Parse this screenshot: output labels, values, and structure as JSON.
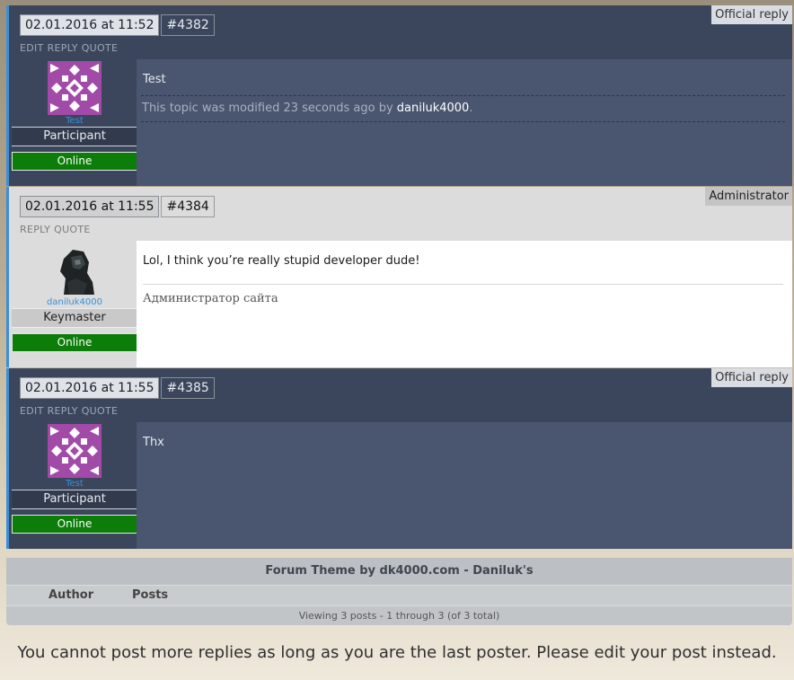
{
  "posts": [
    {
      "date": "02.01.2016 at 11:52",
      "number": "#4382",
      "badge": "Official reply",
      "actions": [
        "EDIT",
        "REPLY",
        "QUOTE"
      ],
      "author_name": "Test",
      "author_role": "Participant",
      "status": "Online",
      "text": "Test",
      "modified_prefix": "This topic was modified 23 seconds ago by",
      "modified_user": "daniluk4000",
      "modified_suffix": "."
    },
    {
      "date": "02.01.2016 at 11:55",
      "number": "#4384",
      "badge": "Administrator",
      "actions": [
        "REPLY",
        "QUOTE"
      ],
      "author_name": "daniluk4000",
      "author_role": "Keymaster",
      "status": "Online",
      "text": "Lol, I think you’re really stupid developer dude!",
      "signature": "Администратор сайта"
    },
    {
      "date": "02.01.2016 at 11:55",
      "number": "#4385",
      "badge": "Official reply",
      "actions": [
        "EDIT",
        "REPLY",
        "QUOTE"
      ],
      "author_name": "Test",
      "author_role": "Participant",
      "status": "Online",
      "text": "Thx"
    }
  ],
  "footer": {
    "credit": "Forum Theme by dk4000.com - Daniluk's",
    "col_author": "Author",
    "col_posts": "Posts",
    "count": "Viewing 3 posts - 1 through 3 (of 3 total)"
  },
  "notice": "You cannot post more replies as long as you are the last poster. Please edit your post instead.",
  "colors": {
    "dark_post_bg": "#3b465d",
    "light_post_bg": "#dcdcdc",
    "online_green": "#0b7d08",
    "accent_blue": "#3a8fd6",
    "identicon_purple": "#a24aa8"
  }
}
